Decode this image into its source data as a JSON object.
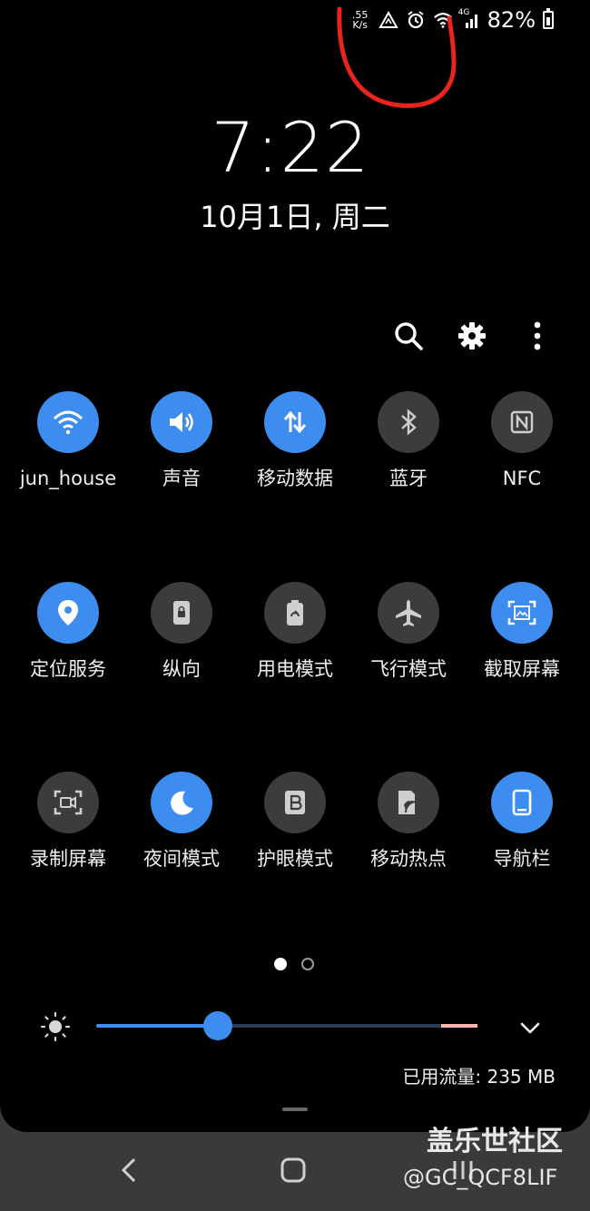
{
  "status_bar": {
    "net_speed_value": ".55",
    "net_speed_unit": "K/s",
    "battery_percent": "82%",
    "icons": [
      "data-saver-icon",
      "alarm-icon",
      "wifi-icon",
      "signal-4g-icon",
      "battery-icon"
    ],
    "network_type": "4G"
  },
  "clock": {
    "time": "7:22",
    "date": "10月1日, 周二"
  },
  "header_icons": [
    "search-icon",
    "settings-gear-icon",
    "more-vert-icon"
  ],
  "tiles": [
    {
      "label": "jun_house",
      "state": "on",
      "icon": "wifi-icon"
    },
    {
      "label": "声音",
      "state": "on",
      "icon": "volume-icon"
    },
    {
      "label": "移动数据",
      "state": "on",
      "icon": "mobile-data-icon"
    },
    {
      "label": "蓝牙",
      "state": "off",
      "icon": "bluetooth-icon"
    },
    {
      "label": "NFC",
      "state": "off",
      "icon": "nfc-icon"
    },
    {
      "label": "定位服务",
      "state": "on",
      "icon": "location-icon"
    },
    {
      "label": "纵向",
      "state": "off",
      "icon": "portrait-lock-icon"
    },
    {
      "label": "用电模式",
      "state": "off",
      "icon": "power-mode-icon"
    },
    {
      "label": "飞行模式",
      "state": "off",
      "icon": "airplane-icon"
    },
    {
      "label": "截取屏幕",
      "state": "on",
      "icon": "screenshot-icon"
    },
    {
      "label": "录制屏幕",
      "state": "off",
      "icon": "screen-record-icon"
    },
    {
      "label": "夜间模式",
      "state": "on",
      "icon": "night-mode-icon"
    },
    {
      "label": "护眼模式",
      "state": "off",
      "icon": "eye-comfort-icon"
    },
    {
      "label": "移动热点",
      "state": "off",
      "icon": "hotspot-icon"
    },
    {
      "label": "导航栏",
      "state": "on",
      "icon": "navigation-bar-icon"
    }
  ],
  "pager": {
    "pages": 2,
    "current": 1
  },
  "brightness": {
    "level": 0.32
  },
  "data_usage": "已用流量: 235 MB",
  "watermark": {
    "title": "盖乐世社区",
    "handle": "@GC_QCF8LIF"
  },
  "colors": {
    "accent": "#3d8cf0",
    "tile_off": "#3c3c3e",
    "annotation": "#e8241c"
  }
}
